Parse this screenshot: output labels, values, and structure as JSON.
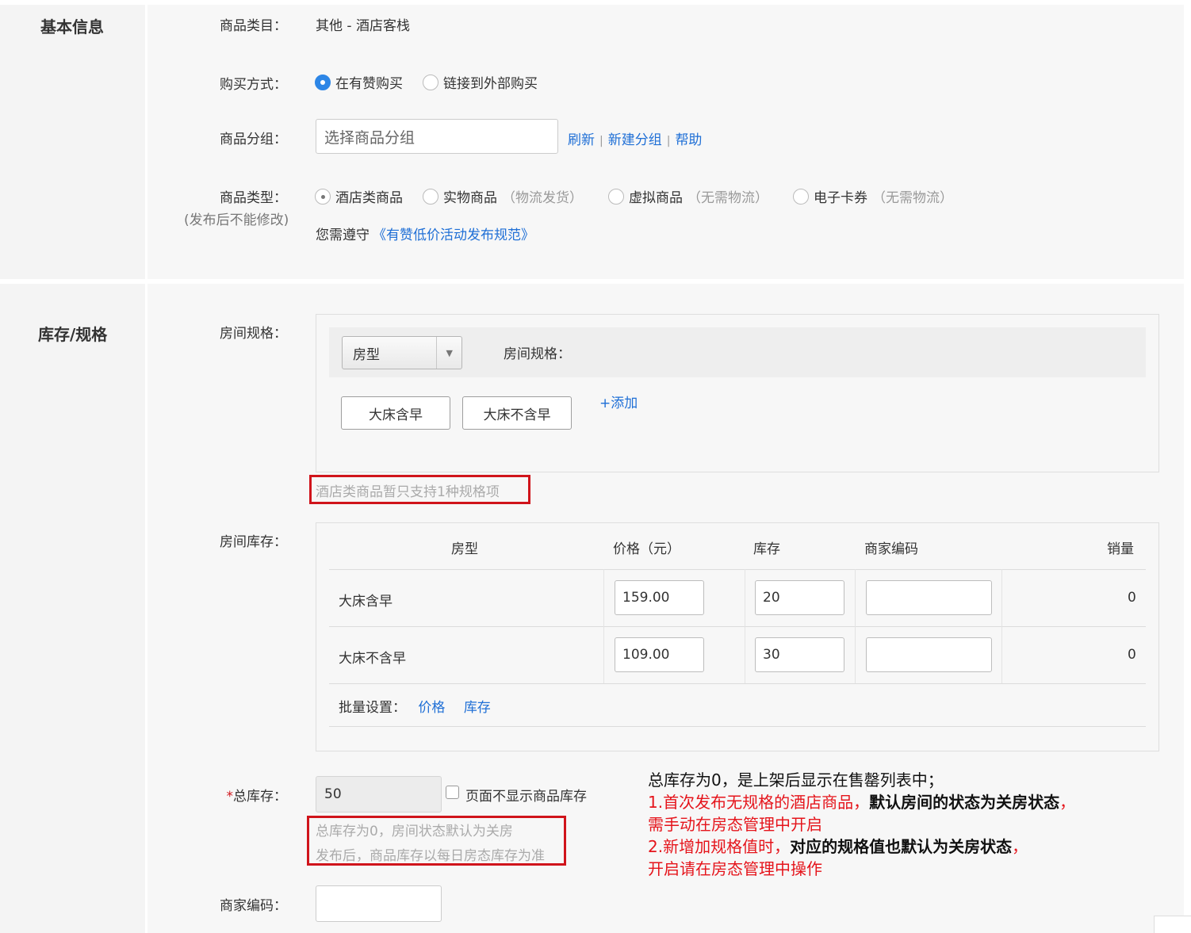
{
  "basic": {
    "title": "基本信息",
    "category_label": "商品类目：",
    "category_value": "其他 - 酒店客栈",
    "buy_label": "购买方式：",
    "buy_options": [
      "在有赞购买",
      "链接到外部购买"
    ],
    "group_label": "商品分组：",
    "group_placeholder": "选择商品分组",
    "group_links": [
      "刷新",
      "新建分组",
      "帮助"
    ],
    "type_label": "商品类型：",
    "type_sub": "(发布后不能修改)",
    "type_options": [
      {
        "name": "酒店类商品",
        "note": ""
      },
      {
        "name": "实物商品",
        "note": "（物流发货）"
      },
      {
        "name": "虚拟商品",
        "note": "（无需物流）"
      },
      {
        "name": "电子卡券",
        "note": "（无需物流）"
      }
    ],
    "rule_prefix": "您需遵守",
    "rule_link": "《有赞低价活动发布规范》"
  },
  "stock": {
    "title": "库存/规格",
    "spec_label": "房间规格：",
    "spec_select": "房型",
    "spec_head_label": "房间规格：",
    "spec_values": [
      "大床含早",
      "大床不含早"
    ],
    "add_link": "+添加",
    "spec_hint": "酒店类商品暂只支持1种规格项",
    "inventory_label": "房间库存：",
    "columns": [
      "房型",
      "价格（元）",
      "库存",
      "商家编码",
      "销量"
    ],
    "rows": [
      {
        "name": "大床含早",
        "price": "159.00",
        "stock": "20",
        "code": "",
        "sales": "0"
      },
      {
        "name": "大床不含早",
        "price": "109.00",
        "stock": "30",
        "code": "",
        "sales": "0"
      }
    ],
    "batch_label": "批量设置：",
    "batch_links": [
      "价格",
      "库存"
    ],
    "total_star": "*",
    "total_label": "总库存：",
    "total_value": "50",
    "hide_stock_label": "页面不显示商品库存",
    "total_hint_1": "总库存为0，房间状态默认为关房",
    "total_hint_2": "发布后，商品库存以每日房态库存为准",
    "code_label": "商家编码："
  },
  "annotation": {
    "line1": "总库存为0，是上架后显示在售罄列表中；",
    "line2_red": "1.首次发布无规格的酒店商品，",
    "line2_black": "默认房间的状态为关房状态",
    "line2_end": "，",
    "line3": "需手动在房态管理中开启",
    "line4_red": "2.新增加规格值时，",
    "line4_black": "对应的规格值也默认为关房状态",
    "line4_end": "，",
    "line5": "开启请在房态管理中操作"
  },
  "colors": {
    "link": "#1f6fd6",
    "radio_active": "#2d86e6",
    "highlight": "#d0141b",
    "note_red": "#e5141b"
  }
}
